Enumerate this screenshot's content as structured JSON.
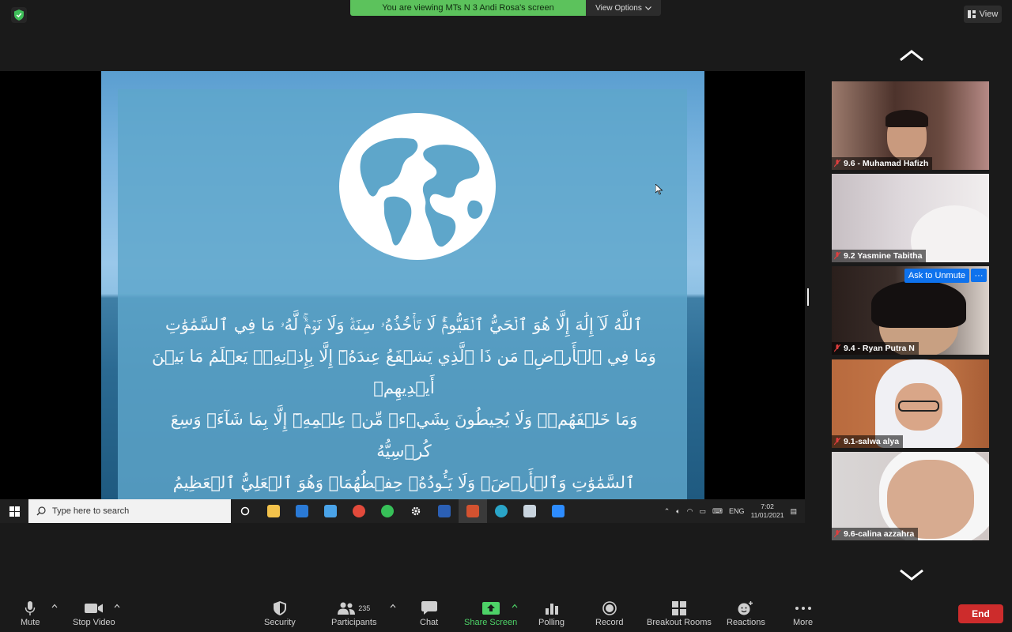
{
  "top": {
    "banner_text": "You are viewing MTs N 3 Andi Rosa's screen",
    "view_options_label": "View Options",
    "view_label": "View"
  },
  "slide": {
    "arabic_lines": [
      "ٱللَّهُ لَآ إِلَٰهَ إِلَّا هُوَ ٱلۡحَيُّ ٱلۡقَيُّومُۚ لَا تَأۡخُذُهُۥ سِنَةٞ وَلَا نَوۡمٞۚ لَّهُۥ مَا فِي ٱلسَّمَٰوَٰتِ",
      "وَمَا فِي ٱلۡأَرۡضِۗ مَن ذَا ٱلَّذِي يَشۡفَعُ عِندَهُۥٓ إِلَّا بِإِذۡنِهِۦۚ يَعۡلَمُ مَا بَيۡنَ أَيۡدِيهِمۡ",
      "وَمَا خَلۡفَهُمۡۖ وَلَا يُحِيطُونَ بِشَيۡءٖ مِّنۡ عِلۡمِهِۦٓ إِلَّا بِمَا شَآءَۚ وَسِعَ كُرۡسِيُّهُ",
      "ٱلسَّمَٰوَٰتِ وَٱلۡأَرۡضَۖ وَلَا يَـُٔودُهُۥ حِفۡظُهُمَاۚ وَهُوَ ٱلۡعَلِيُّ ٱلۡعَظِيمُ"
    ]
  },
  "taskbar": {
    "search_placeholder": "Type here to search",
    "lang": "ENG",
    "time": "7:02",
    "date": "11/01/2021"
  },
  "participants": [
    {
      "name": "9.6 - Muhamad Hafizh"
    },
    {
      "name": "9.2 Yasmine Tabitha"
    },
    {
      "name": "9.4 - Ryan Putra N",
      "ask_unmute": "Ask to Unmute",
      "more": "···"
    },
    {
      "name": "9.1-salwa alya"
    },
    {
      "name": "9.6-calina azzahra"
    }
  ],
  "toolbar": {
    "mute": "Mute",
    "stop_video": "Stop Video",
    "security": "Security",
    "participants": "Participants",
    "participants_count": "235",
    "chat": "Chat",
    "share_screen": "Share Screen",
    "polling": "Polling",
    "record": "Record",
    "breakout_rooms": "Breakout Rooms",
    "reactions": "Reactions",
    "more": "More",
    "end": "End"
  },
  "colors": {
    "banner_green": "#5cc25c",
    "share_green": "#4dd267",
    "end_red": "#cd2c2c",
    "zoom_blue": "#0e72ed"
  }
}
